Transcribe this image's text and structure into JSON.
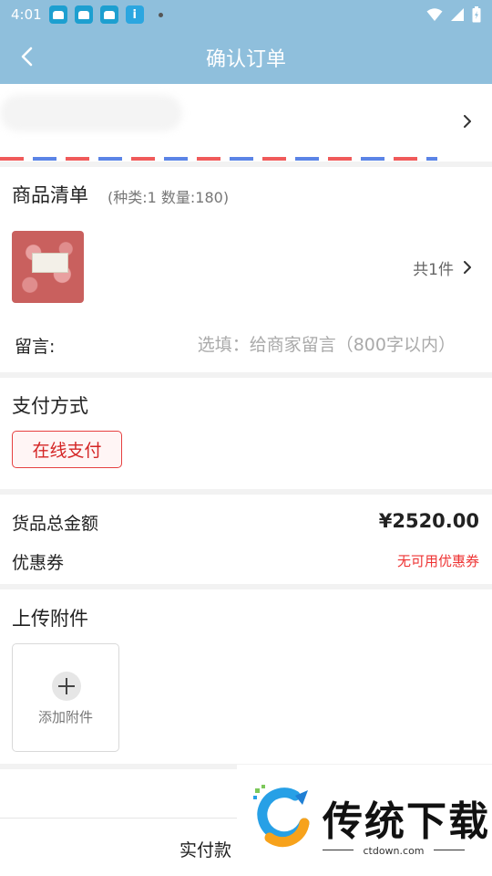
{
  "status_bar": {
    "time": "4:01",
    "info_icon": "i"
  },
  "header": {
    "title": "确认订单"
  },
  "goods": {
    "title": "商品清单",
    "summary": "(种类:1 数量:180)",
    "count_prefix": "共",
    "count": "1",
    "count_suffix": "件"
  },
  "remark": {
    "label": "留言:",
    "placeholder": "选填：给商家留言（800字以内）",
    "value": ""
  },
  "payment": {
    "title": "支付方式",
    "option": "在线支付"
  },
  "amounts": {
    "total_label": "货品总金额",
    "total_value": "¥2520.00",
    "coupon_label": "优惠券",
    "coupon_value": "无可用优惠券"
  },
  "attachment": {
    "title": "上传附件",
    "add_label": "添加附件"
  },
  "bottom_bar": {
    "pay_label": "实付款"
  },
  "watermark": {
    "name": "传统下载",
    "url": "ctdown.com"
  },
  "colors": {
    "header_bg": "#8fbfdc",
    "accent_red": "#e64040",
    "airmail_red": "#f05a5a",
    "airmail_blue": "#5b84e6"
  },
  "icons": [
    "back-arrow-icon",
    "chevron-right-icon",
    "plus-icon",
    "wifi-icon",
    "signal-icon",
    "battery-icon",
    "car-app-icon",
    "info-app-icon"
  ]
}
